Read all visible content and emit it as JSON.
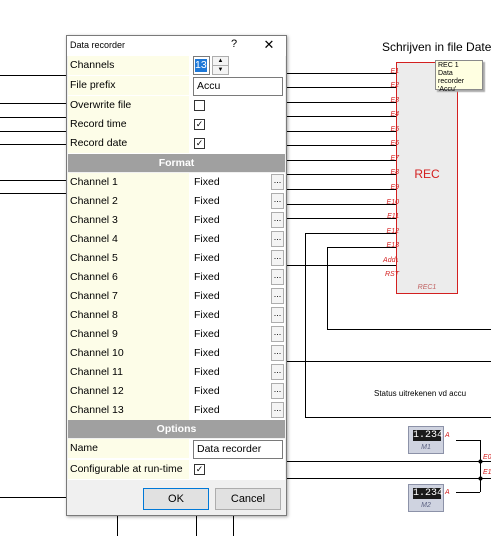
{
  "canvas": {
    "title": "Schrijven in file Datei",
    "status_text": "Status uitrekenen vd accu"
  },
  "rec_block": {
    "label": "REC",
    "id": "REC1",
    "ports": [
      "E1",
      "E2",
      "E3",
      "E4",
      "E5",
      "E6",
      "E7",
      "E8",
      "E9",
      "E10",
      "E11",
      "E12",
      "E13",
      "Add↓",
      "RST"
    ]
  },
  "tooltip": {
    "line1": "REC 1",
    "line2": "Data recorder",
    "line3": "'Accu'"
  },
  "meters": [
    {
      "value": "1.234",
      "name": "M1",
      "port": "A"
    },
    {
      "value": "1.234",
      "name": "M2",
      "port": "A"
    }
  ],
  "side_ports": [
    "E0",
    "E1"
  ],
  "dialog": {
    "title": "Data recorder",
    "help_icon": "?",
    "close_icon": "✕",
    "general": {
      "channels_label": "Channels",
      "channels_value": "13",
      "file_prefix_label": "File prefix",
      "file_prefix_value": "Accu",
      "overwrite_label": "Overwrite file",
      "overwrite_checked": false,
      "record_time_label": "Record time",
      "record_time_checked": true,
      "record_date_label": "Record date",
      "record_date_checked": true
    },
    "format_header": "Format",
    "channels": [
      {
        "label": "Channel 1",
        "format": "Fixed"
      },
      {
        "label": "Channel 2",
        "format": "Fixed"
      },
      {
        "label": "Channel 3",
        "format": "Fixed"
      },
      {
        "label": "Channel 4",
        "format": "Fixed"
      },
      {
        "label": "Channel 5",
        "format": "Fixed"
      },
      {
        "label": "Channel 6",
        "format": "Fixed"
      },
      {
        "label": "Channel 7",
        "format": "Fixed"
      },
      {
        "label": "Channel 8",
        "format": "Fixed"
      },
      {
        "label": "Channel 9",
        "format": "Fixed"
      },
      {
        "label": "Channel 10",
        "format": "Fixed"
      },
      {
        "label": "Channel 11",
        "format": "Fixed"
      },
      {
        "label": "Channel 12",
        "format": "Fixed"
      },
      {
        "label": "Channel 13",
        "format": "Fixed"
      }
    ],
    "ellipsis_label": "...",
    "options_header": "Options",
    "options": {
      "name_label": "Name",
      "name_value": "Data recorder",
      "configurable_label": "Configurable at run-time",
      "configurable_checked": true
    },
    "ok_label": "OK",
    "cancel_label": "Cancel"
  },
  "colors": {
    "port_red": "#d32020",
    "grid_label_bg": "#fdfde8",
    "section_header_bg": "#a0a0a0",
    "selection_blue": "#1e78d7"
  }
}
